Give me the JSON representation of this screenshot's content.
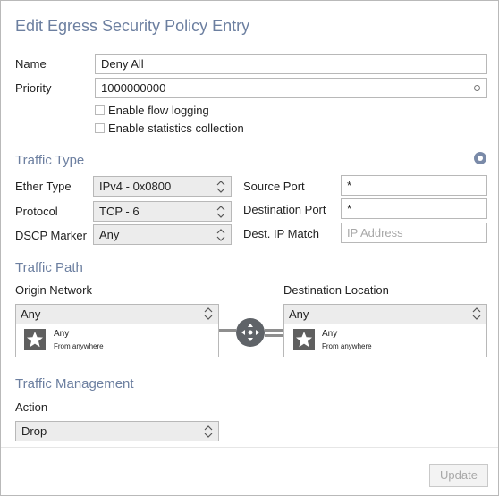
{
  "dialog": {
    "title": "Edit Egress Security Policy Entry"
  },
  "general": {
    "name_label": "Name",
    "name_value": "Deny All",
    "priority_label": "Priority",
    "priority_value": "1000000000",
    "flow_logging_label": "Enable flow logging",
    "statistics_label": "Enable statistics collection",
    "flow_logging_checked": false,
    "statistics_checked": false
  },
  "traffic_type": {
    "heading": "Traffic Type",
    "ether_type_label": "Ether Type",
    "ether_type_value": "IPv4 - 0x0800",
    "protocol_label": "Protocol",
    "protocol_value": "TCP - 6",
    "dscp_label": "DSCP Marker",
    "dscp_value": "Any",
    "source_port_label": "Source Port",
    "source_port_value": "*",
    "dest_port_label": "Destination Port",
    "dest_port_value": "*",
    "dest_ip_label": "Dest. IP Match",
    "dest_ip_placeholder": "IP Address"
  },
  "traffic_path": {
    "heading": "Traffic Path",
    "origin_label": "Origin Network",
    "origin_select": "Any",
    "origin_name": "Any",
    "origin_sub": "From anywhere",
    "dest_label": "Destination Location",
    "dest_select": "Any",
    "dest_name": "Any",
    "dest_sub": "From anywhere"
  },
  "traffic_management": {
    "heading": "Traffic Management",
    "action_label": "Action",
    "action_value": "Drop"
  },
  "footer": {
    "update_label": "Update"
  },
  "colors": {
    "accent": "#6c7fa0",
    "border": "#b8b8b8",
    "select_bg": "#ececec"
  }
}
